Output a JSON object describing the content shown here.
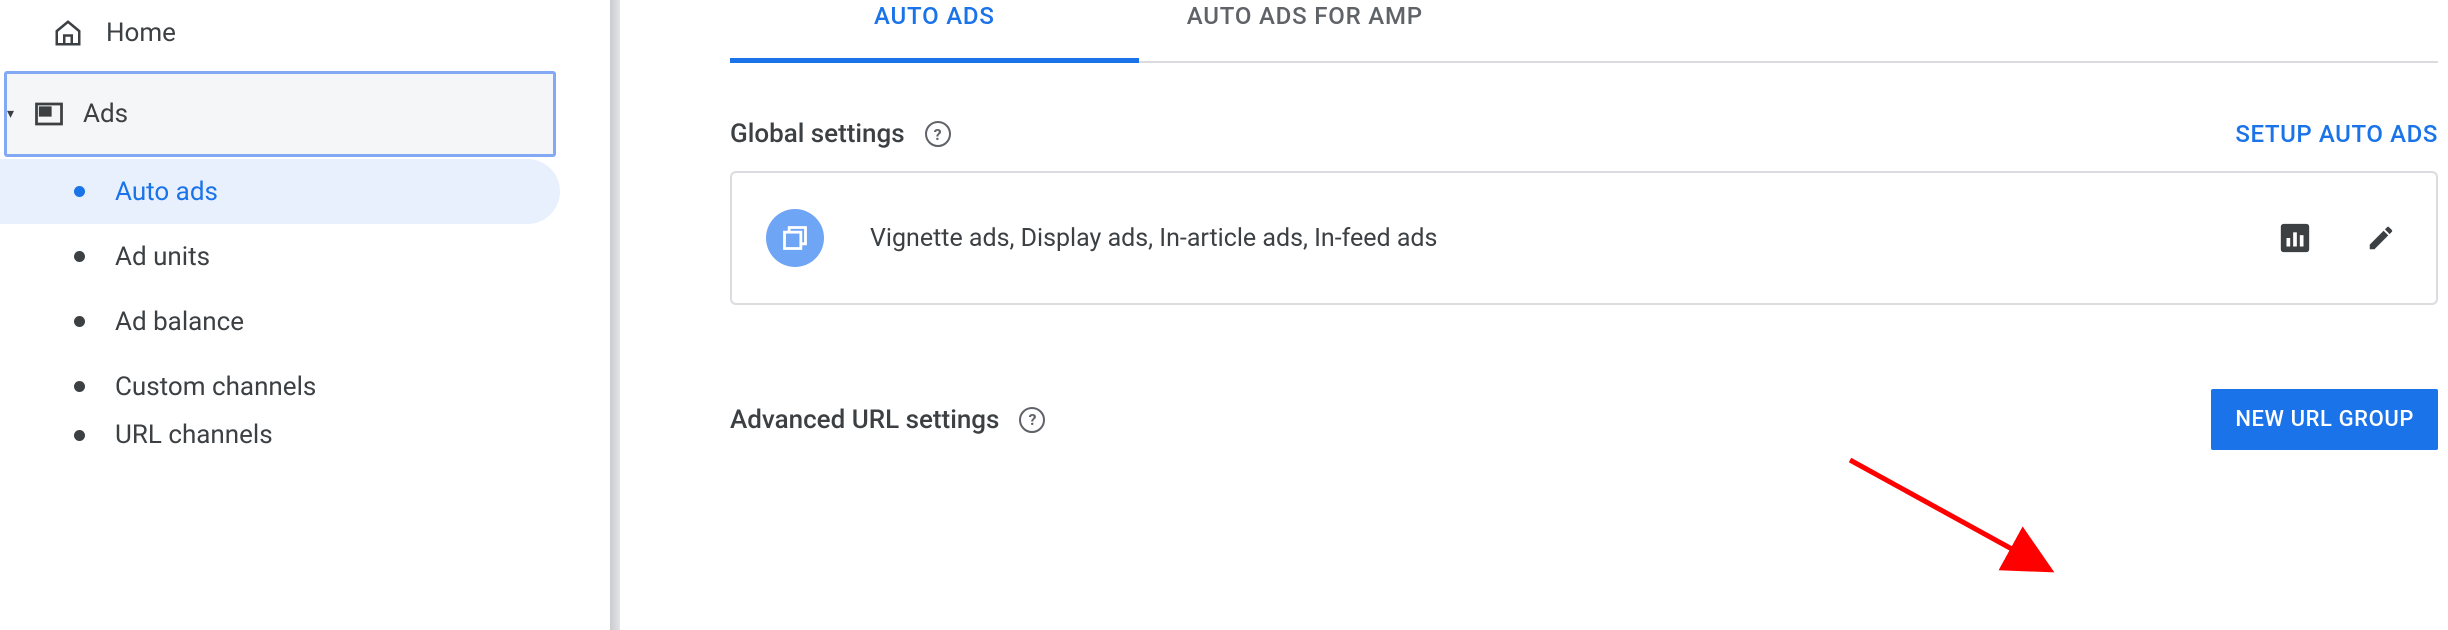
{
  "sidebar": {
    "home": "Home",
    "ads": "Ads",
    "sub": {
      "auto_ads": "Auto ads",
      "ad_units": "Ad units",
      "ad_balance": "Ad balance",
      "custom_channels": "Custom channels",
      "url_channels": "URL channels"
    }
  },
  "tabs": {
    "auto_ads": "AUTO ADS",
    "auto_ads_amp": "AUTO ADS FOR AMP"
  },
  "global": {
    "title": "Global settings",
    "setup_link": "SETUP AUTO ADS",
    "card_text": "Vignette ads, Display ads, In-article ads, In-feed ads"
  },
  "advanced": {
    "title": "Advanced URL settings",
    "new_group_btn": "NEW URL GROUP"
  },
  "colors": {
    "accent": "#1a73e8"
  }
}
